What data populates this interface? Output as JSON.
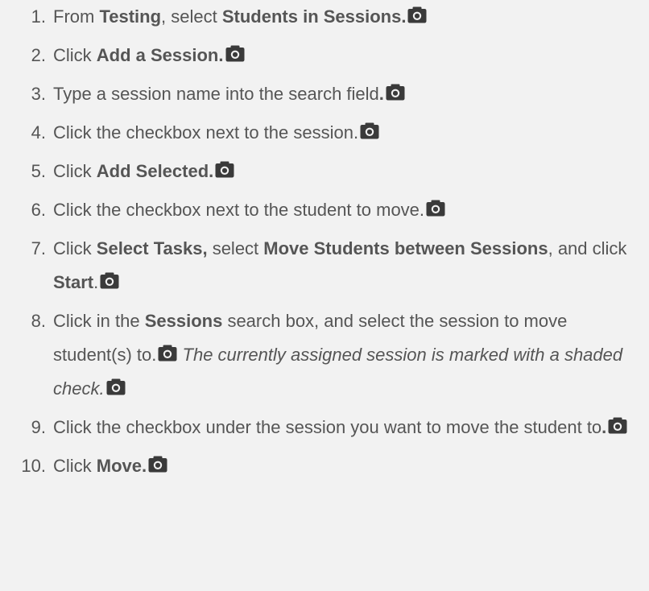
{
  "steps": [
    {
      "num": "1.",
      "parts": [
        {
          "t": "From "
        },
        {
          "t": "Testing",
          "b": true
        },
        {
          "t": ", select "
        },
        {
          "t": "Students in Sessions.",
          "b": true
        },
        {
          "icon": "camera-icon"
        }
      ]
    },
    {
      "num": "2.",
      "parts": [
        {
          "t": "Click "
        },
        {
          "t": "Add a Session.",
          "b": true
        },
        {
          "icon": "camera-icon"
        }
      ]
    },
    {
      "num": "3.",
      "parts": [
        {
          "t": "Type a session name into the search field"
        },
        {
          "t": ".",
          "b": true
        },
        {
          "icon": "camera-icon"
        }
      ]
    },
    {
      "num": "4.",
      "parts": [
        {
          "t": "Click the checkbox next to the session."
        },
        {
          "icon": "camera-icon"
        }
      ]
    },
    {
      "num": "5.",
      "parts": [
        {
          "t": "Click "
        },
        {
          "t": "Add Selected.",
          "b": true
        },
        {
          "icon": "camera-icon"
        }
      ]
    },
    {
      "num": "6.",
      "parts": [
        {
          "t": "Click the checkbox next to the student to move."
        },
        {
          "icon": "camera-icon"
        }
      ]
    },
    {
      "num": "7.",
      "parts": [
        {
          "t": "Click "
        },
        {
          "t": "Select Tasks,",
          "b": true
        },
        {
          "t": " select "
        },
        {
          "t": "Move Students between Sessions",
          "b": true
        },
        {
          "t": ", and click "
        },
        {
          "t": "Start",
          "b": true
        },
        {
          "t": "."
        },
        {
          "icon": "camera-icon"
        }
      ]
    },
    {
      "num": "8.",
      "parts": [
        {
          "t": "Click in the "
        },
        {
          "t": "Sessions",
          "b": true
        },
        {
          "t": " search box, and select the session to move student(s) to."
        },
        {
          "icon": "camera-icon"
        },
        {
          "t": " "
        },
        {
          "t": "The currently assigned session is marked with a shaded check.",
          "i": true
        },
        {
          "icon": "camera-icon"
        }
      ]
    },
    {
      "num": "9.",
      "parts": [
        {
          "t": "Click the checkbox under the session you want to move the student to"
        },
        {
          "t": ".",
          "b": true
        },
        {
          "icon": "camera-icon"
        }
      ]
    },
    {
      "num": "10.",
      "parts": [
        {
          "t": "Click "
        },
        {
          "t": "Move.",
          "b": true
        },
        {
          "icon": "camera-icon"
        }
      ]
    }
  ],
  "colors": {
    "text": "#555555",
    "background": "#f2f2f2",
    "icon": "#3a3a3a"
  }
}
